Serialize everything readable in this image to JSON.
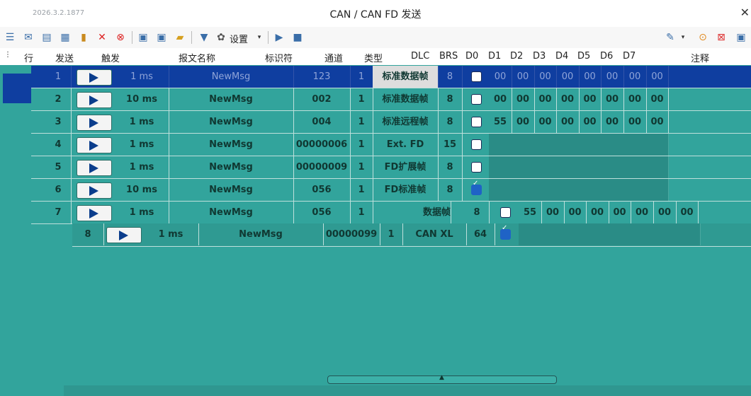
{
  "window": {
    "version": "2026.3.2.1877",
    "title": "CAN / CAN FD 发送"
  },
  "toolbar": {
    "settings_label": "设置",
    "icons": [
      "add-row-icon",
      "send-icon",
      "copy-icon",
      "paste-icon",
      "clipboard-icon",
      "delete-icon",
      "clear-icon",
      "save-icon",
      "save-as-icon",
      "open-icon",
      "filter-icon",
      "gear-icon",
      "play-icon",
      "stop-icon",
      "wrench-icon",
      "link-icon",
      "remove-icon",
      "export-icon"
    ]
  },
  "columns": [
    "行",
    "发送",
    "触发",
    "报文名称",
    "标识符",
    "通道",
    "类型",
    "DLC",
    "BRS",
    "D0",
    "D1",
    "D2",
    "D3",
    "D4",
    "D5",
    "D6",
    "D7",
    "注释"
  ],
  "rows": [
    {
      "row": "1",
      "trigger": "1 ms",
      "name": "NewMsg",
      "id": "123",
      "channel": "1",
      "type": "标准数据帧",
      "dlc": "8",
      "brs": false,
      "data": [
        "00",
        "00",
        "00",
        "00",
        "00",
        "00",
        "00",
        "00"
      ]
    },
    {
      "row": "2",
      "trigger": "10 ms",
      "name": "NewMsg",
      "id": "002",
      "channel": "1",
      "type": "标准数据帧",
      "dlc": "8",
      "brs": false,
      "data": [
        "00",
        "00",
        "00",
        "00",
        "00",
        "00",
        "00",
        "00"
      ]
    },
    {
      "row": "3",
      "trigger": "1 ms",
      "name": "NewMsg",
      "id": "004",
      "channel": "1",
      "type": "标准远程帧",
      "dlc": "8",
      "brs": false,
      "data": [
        "55",
        "00",
        "00",
        "00",
        "00",
        "00",
        "00",
        "00"
      ]
    },
    {
      "row": "4",
      "trigger": "1 ms",
      "name": "NewMsg",
      "id": "00000006",
      "channel": "1",
      "type": "Ext. FD",
      "dlc": "15",
      "brs": false,
      "data": []
    },
    {
      "row": "5",
      "trigger": "1 ms",
      "name": "NewMsg",
      "id": "00000009",
      "channel": "1",
      "type": "FD扩展帧",
      "dlc": "8",
      "brs": false,
      "data": []
    },
    {
      "row": "6",
      "trigger": "10 ms",
      "name": "NewMsg",
      "id": "056",
      "channel": "1",
      "type": "FD标准帧",
      "dlc": "8",
      "brs": true,
      "data": []
    },
    {
      "row": "7",
      "trigger": "1 ms",
      "name": "NewMsg",
      "id": "056",
      "channel": "1",
      "type": "数据帧",
      "dlc": "8",
      "brs": false,
      "data": [
        "55",
        "00",
        "00",
        "00",
        "00",
        "00",
        "00",
        "00"
      ]
    },
    {
      "row": "8",
      "trigger": "1 ms",
      "name": "NewMsg",
      "id": "00000099",
      "channel": "1",
      "type": "CAN XL",
      "dlc": "64",
      "brs": true,
      "data": []
    }
  ],
  "colors": {
    "grid_bg": "#32a49c",
    "selected_row": "#0f3ea0",
    "play_arrow": "#0b3d8c"
  }
}
